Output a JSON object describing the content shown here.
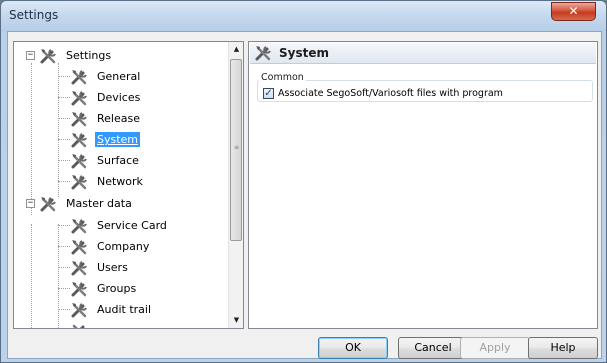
{
  "window": {
    "title": "Settings",
    "close_glyph": "✕"
  },
  "tree": {
    "items": [
      {
        "label": "Settings",
        "expander": "−"
      },
      {
        "label": "General"
      },
      {
        "label": "Devices"
      },
      {
        "label": "Release"
      },
      {
        "label": "System",
        "selected": true
      },
      {
        "label": "Surface"
      },
      {
        "label": "Network"
      },
      {
        "label": "Master data",
        "expander": "−"
      },
      {
        "label": "Service Card"
      },
      {
        "label": "Company"
      },
      {
        "label": "Users"
      },
      {
        "label": "Groups"
      },
      {
        "label": "Audit trail"
      }
    ],
    "scroll_up": "▲",
    "scroll_down": "▼",
    "thumb_grip": "≡"
  },
  "content": {
    "title": "System",
    "group_label": "Common",
    "checkbox": {
      "label": "Associate SegoSoft/Variosoft files with program",
      "checked": true,
      "glyph": "✓"
    }
  },
  "buttons": {
    "ok": "OK",
    "cancel": "Cancel",
    "apply": "Apply",
    "help": "Help"
  },
  "colors": {
    "selection": "#3399ff",
    "icon": "tools-icon"
  }
}
